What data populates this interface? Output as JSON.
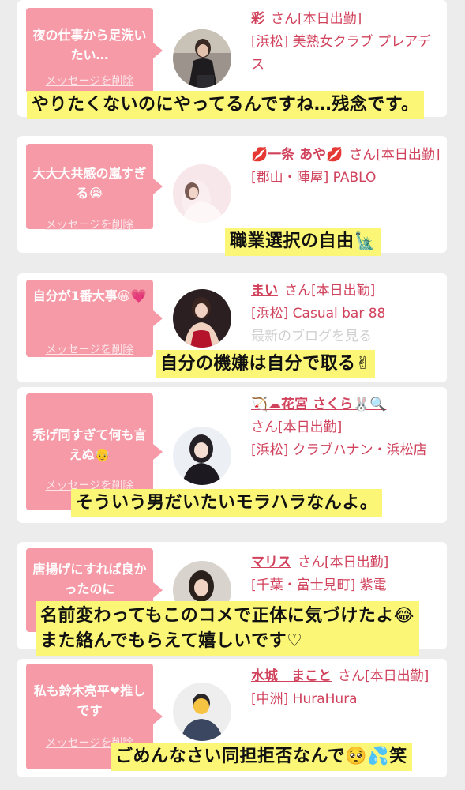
{
  "delete_label": "メッセージを削除",
  "colors": {
    "bubble": "#f59aa6",
    "name": "#d1425c",
    "caption_bg": "#fbf676",
    "page_bg": "#ececec"
  },
  "items": [
    {
      "message": "夜の仕事から足洗いたい…",
      "name": "彩",
      "suffix": "さん[本日出勤]",
      "shop": "[浜松] 美熟女クラブ プレアデス",
      "extra": "",
      "caption": "やりたくないのにやってるんですね…残念です。"
    },
    {
      "message": "大大大共感の嵐すぎる😭",
      "name": "💋一条 あや💋",
      "suffix": "さん[本日出勤]",
      "shop": "[郡山・陣屋] PABLO",
      "extra": "",
      "caption": "職業選択の自由🗽"
    },
    {
      "message": "自分が1番大事😀💗",
      "name": "まい",
      "suffix": "さん[本日出勤]",
      "shop": "[浜松] Casual bar 88",
      "extra": "最新のブログを見る",
      "caption": "自分の機嫌は自分で取る✌"
    },
    {
      "message": "禿げ同すぎて何も言えぬ👴",
      "name": "🏹☁花宮 さくら🐰🔍",
      "suffix": "さん[本日出勤]",
      "shop": "[浜松] クラブハナン・浜松店",
      "extra": "",
      "caption": "そういう男だいたいモラハラなんよ。"
    },
    {
      "message": "唐揚げにすれば良かったのに",
      "name": "マリス",
      "suffix": "さん[本日出勤]",
      "shop": "[千葉・富士見町] 紫電",
      "extra": "",
      "caption_line1": "名前変わってもこのコメで正体に気づけたよ😂",
      "caption_line2": "また絡んでもらえて嬉しいです♡"
    },
    {
      "message": "私も鈴木亮平❤推しです",
      "name": "水城　まこと",
      "suffix": "さん[本日出勤]",
      "shop": "[中洲] HuraHura",
      "extra": "",
      "caption": "ごめんなさい同担拒否なんで🥺💦笑"
    }
  ]
}
